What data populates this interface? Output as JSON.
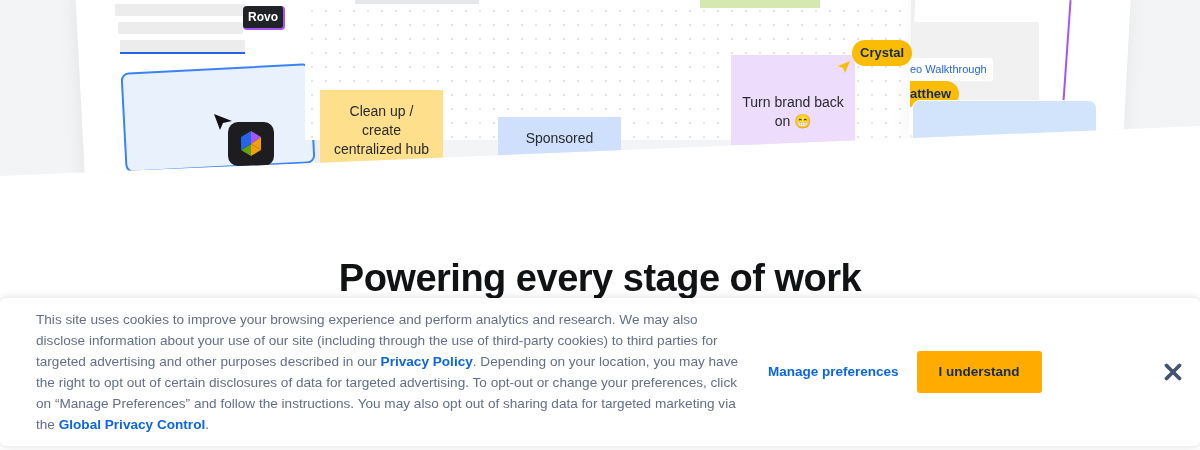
{
  "hero": {
    "left_card": {
      "tag": "Rovo"
    },
    "whiteboard": {
      "stickies": [
        {
          "text": "Clean up / create centralized hub",
          "color": "#fddf8c"
        },
        {
          "text": "Sponsored",
          "color": "#cfe0fc"
        },
        {
          "text": "Turn brand back on 😁",
          "color": "#eddcfc"
        }
      ],
      "cursor_tag": "Crystal"
    },
    "right_card": {
      "chip": "eo Walkthrough",
      "cursor_tag": "atthew"
    }
  },
  "section": {
    "heading": "Powering every stage of work"
  },
  "cookie_banner": {
    "text_parts": [
      {
        "kind": "text",
        "text": "This site uses cookies to improve your browsing experience and perform analytics and research. We may also disclose information about your use of our site (including through the use of third-party cookies) to third parties for targeted advertising and other purposes described in our "
      },
      {
        "kind": "link",
        "text": "Privacy Policy"
      },
      {
        "kind": "text",
        "text": ". Depending on your location, you may have the right to opt out of certain disclosures of data for targeted advertising. To opt-out or change your preferences, click on “Manage Preferences” and follow the instructions. You may also opt out of sharing data for targeted marketing via the "
      },
      {
        "kind": "link",
        "text": "Global Privacy Control"
      },
      {
        "kind": "text",
        "text": "."
      }
    ],
    "manage_button": "Manage preferences",
    "accept_button": "I understand"
  }
}
